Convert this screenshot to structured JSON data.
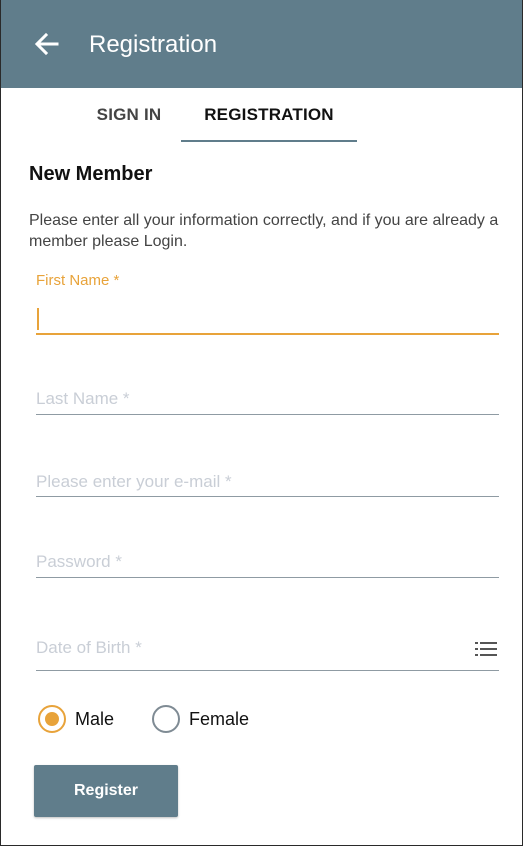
{
  "appbar": {
    "title": "Registration",
    "back_icon": "arrow-left-icon",
    "color": "#607d8b"
  },
  "tabs": [
    {
      "label": "SIGN IN",
      "active": false
    },
    {
      "label": "REGISTRATION",
      "active": true
    }
  ],
  "form": {
    "heading": "New Member",
    "intro": "Please enter all your information correctly, and if you are already a member please Login.",
    "first_name": {
      "label": "First Name *",
      "value": ""
    },
    "last_name": {
      "placeholder": "Last Name *"
    },
    "email": {
      "placeholder": "Please enter your e-mail *"
    },
    "password": {
      "placeholder": "Password *"
    },
    "dob": {
      "placeholder": "Date of Birth *",
      "icon": "list-icon"
    },
    "gender": {
      "options": [
        {
          "label": "Male",
          "selected": true
        },
        {
          "label": "Female",
          "selected": false
        }
      ]
    },
    "register_label": "Register"
  },
  "colors": {
    "accent": "#e8a33a",
    "primary": "#607d8b",
    "placeholder": "#c9ced6"
  }
}
